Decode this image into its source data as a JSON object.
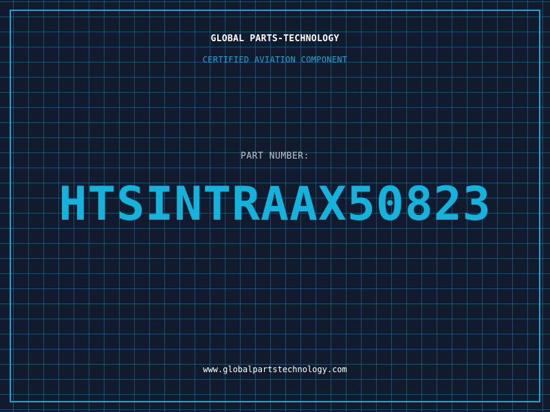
{
  "header": {
    "company": "GLOBAL PARTS-TECHNOLOGY",
    "tagline": "CERTIFIED AVIATION COMPONENT"
  },
  "part": {
    "label": "PART NUMBER:",
    "number": "HTSINTRAAX50823"
  },
  "footer": {
    "website": "www.globalpartstechnology.com"
  },
  "colors": {
    "background": "#111b2d",
    "grid": "#2778a0",
    "accent": "#1aa6d6",
    "text": "#ffffff"
  }
}
